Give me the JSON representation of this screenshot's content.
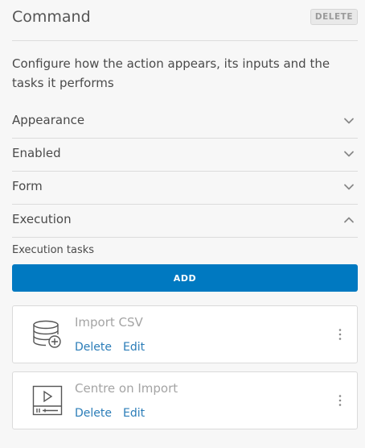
{
  "header": {
    "title": "Command",
    "delete_label": "DELETE"
  },
  "description": "Configure how the action appears, its inputs and the tasks it performs",
  "sections": [
    {
      "label": "Appearance",
      "expanded": false
    },
    {
      "label": "Enabled",
      "expanded": false
    },
    {
      "label": "Form",
      "expanded": false
    },
    {
      "label": "Execution",
      "expanded": true
    }
  ],
  "execution": {
    "tasks_label": "Execution tasks",
    "add_label": "ADD",
    "tasks": [
      {
        "title": "Import CSV",
        "icon": "database-add-icon",
        "delete_label": "Delete",
        "edit_label": "Edit"
      },
      {
        "title": "Centre on Import",
        "icon": "map-play-icon",
        "delete_label": "Delete",
        "edit_label": "Edit"
      }
    ]
  },
  "colors": {
    "accent": "#0079c1",
    "link": "#2b7db8",
    "background": "#f7f7f7"
  }
}
